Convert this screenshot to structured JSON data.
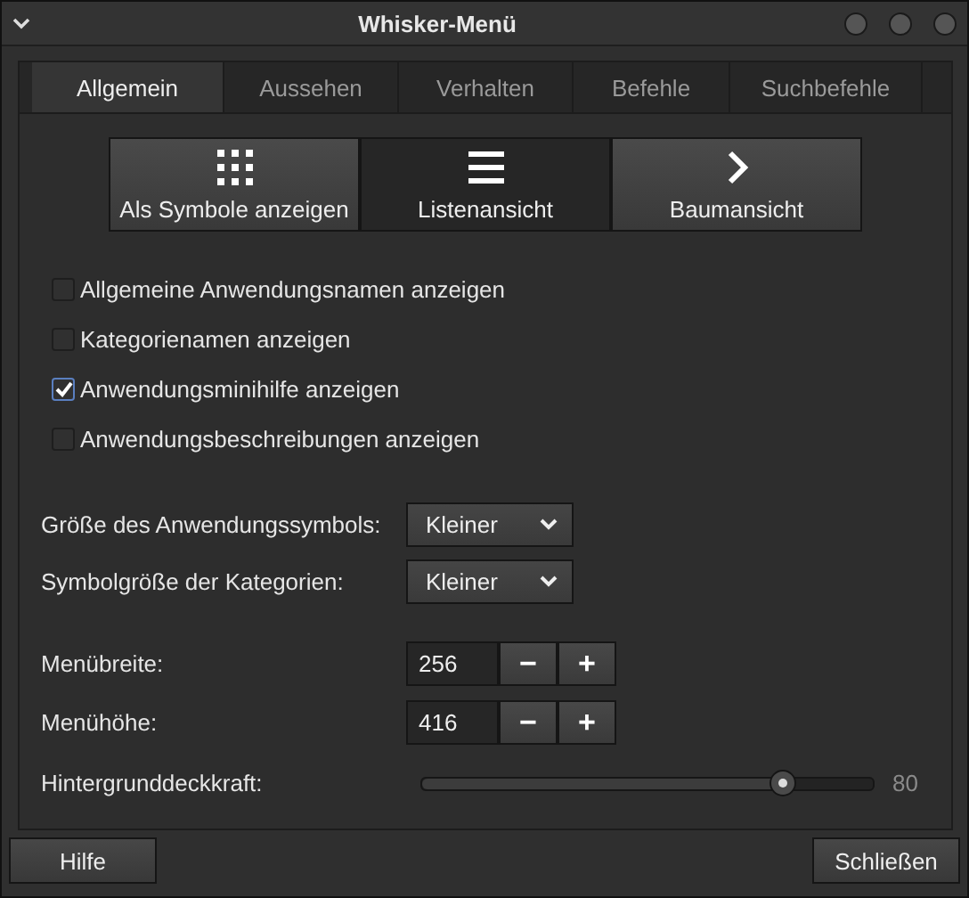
{
  "window": {
    "title": "Whisker-Menü"
  },
  "tabs": [
    {
      "label": "Allgemein",
      "selected": true
    },
    {
      "label": "Aussehen",
      "selected": false
    },
    {
      "label": "Verhalten",
      "selected": false
    },
    {
      "label": "Befehle",
      "selected": false
    },
    {
      "label": "Suchbefehle",
      "selected": false
    }
  ],
  "view_modes": [
    {
      "label": "Als Symbole anzeigen",
      "kind": "grid",
      "selected": false
    },
    {
      "label": "Listenansicht",
      "kind": "list",
      "selected": true
    },
    {
      "label": "Baumansicht",
      "kind": "tree",
      "selected": false
    }
  ],
  "checkboxes": [
    {
      "label": "Allgemeine Anwendungsnamen anzeigen",
      "checked": false
    },
    {
      "label": "Kategorienamen anzeigen",
      "checked": false
    },
    {
      "label": "Anwendungsminihilfe anzeigen",
      "checked": true
    },
    {
      "label": "Anwendungsbeschreibungen anzeigen",
      "checked": false
    }
  ],
  "dropdowns": [
    {
      "label": "Größe des Anwendungssymbols:",
      "value": "Kleiner"
    },
    {
      "label": "Symbolgröße der Kategorien:",
      "value": "Kleiner"
    }
  ],
  "spinners": [
    {
      "label": "Menübreite:",
      "value": "256",
      "decrement": "−",
      "increment": "+"
    },
    {
      "label": "Menühöhe:",
      "value": "416",
      "decrement": "−",
      "increment": "+"
    }
  ],
  "slider": {
    "label": "Hintergrunddeckkraft:",
    "level": 0.8,
    "reading": "80"
  },
  "buttons": [
    {
      "label": "Hilfe"
    },
    {
      "label": "Schließen"
    }
  ]
}
